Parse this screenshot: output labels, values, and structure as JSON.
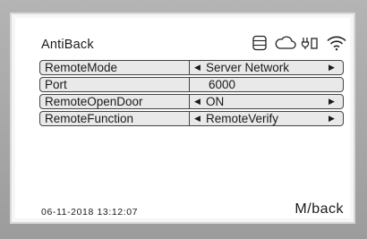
{
  "screen": {
    "title": "AntiBack"
  },
  "status_icons": [
    "storage-icon",
    "cloud-icon",
    "plug-icon",
    "wifi-icon"
  ],
  "settings": [
    {
      "label": "RemoteMode",
      "value": "Server Network",
      "has_arrows": true
    },
    {
      "label": "Port",
      "value": "6000",
      "has_arrows": false
    },
    {
      "label": "RemoteOpenDoor",
      "value": "ON",
      "has_arrows": true
    },
    {
      "label": "RemoteFunction",
      "value": "RemoteVerify",
      "has_arrows": true
    }
  ],
  "footer": {
    "datetime": "06-11-2018  13:12:07",
    "back_hint": "M/back"
  }
}
